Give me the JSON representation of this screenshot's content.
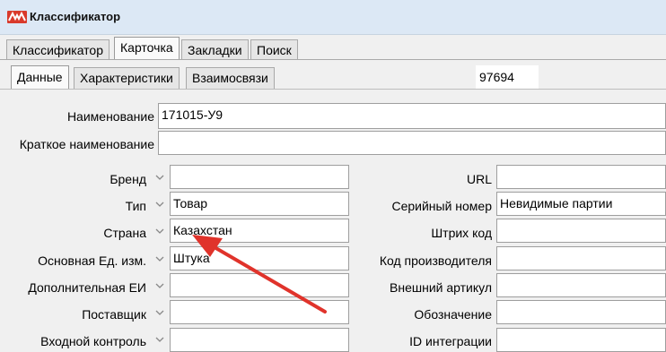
{
  "window": {
    "title": "Классификатор"
  },
  "main_tabs": [
    "Классификатор",
    "Карточка",
    "Закладки",
    "Поиск"
  ],
  "sub_tabs": [
    "Данные",
    "Характеристики",
    "Взаимосвязи"
  ],
  "record_id": "97694",
  "fields": {
    "name": {
      "label": "Наименование",
      "value": "171015-У9"
    },
    "short_name": {
      "label": "Краткое наименование",
      "value": ""
    },
    "brand": {
      "label": "Бренд",
      "value": ""
    },
    "type": {
      "label": "Тип",
      "value": "Товар"
    },
    "country": {
      "label": "Страна",
      "value": "Казахстан"
    },
    "main_unit": {
      "label": "Основная Ед. изм.",
      "value": "Штука"
    },
    "extra_unit": {
      "label": "Дополнительная ЕИ",
      "value": ""
    },
    "supplier": {
      "label": "Поставщик",
      "value": ""
    },
    "incoming_control": {
      "label": "Входной контроль",
      "value": ""
    },
    "url": {
      "label": "URL",
      "value": ""
    },
    "serial_number": {
      "label": "Серийный номер",
      "value": "Невидимые партии"
    },
    "barcode": {
      "label": "Штрих код",
      "value": ""
    },
    "manufacturer_code": {
      "label": "Код производителя",
      "value": ""
    },
    "external_article": {
      "label": "Внешний артикул",
      "value": ""
    },
    "designation": {
      "label": "Обозначение",
      "value": ""
    },
    "integration_id": {
      "label": "ID интеграции",
      "value": ""
    }
  },
  "colors": {
    "accent": "#d93a2b",
    "titlebar": "#dce8f5"
  }
}
